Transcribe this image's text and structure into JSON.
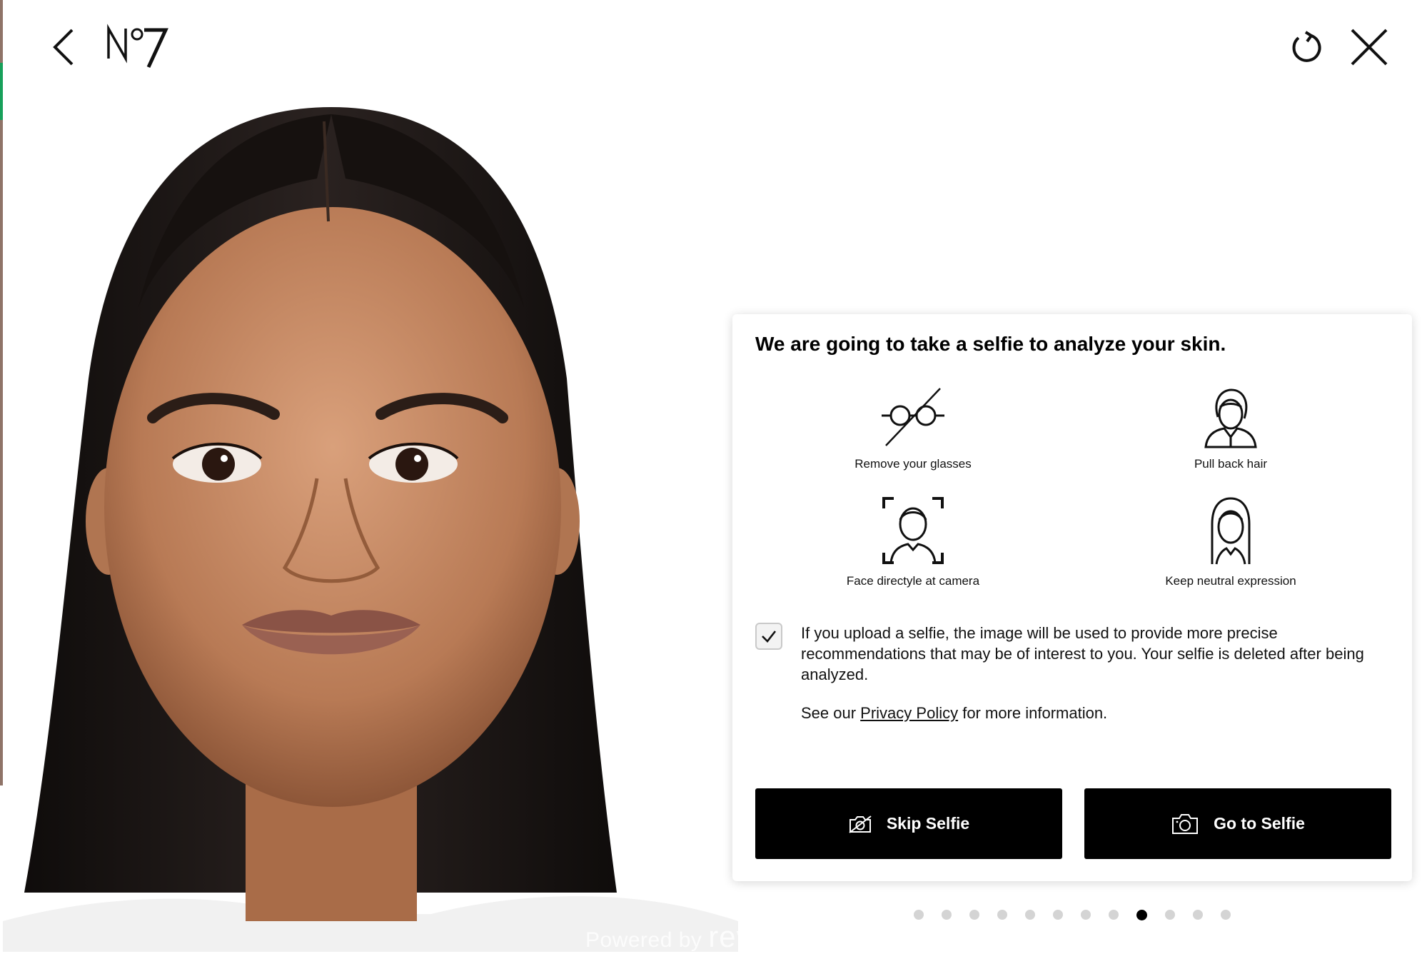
{
  "brand": {
    "logo_text": "Nº7"
  },
  "header": {
    "back_icon": "chevron-left-icon",
    "refresh_icon": "refresh-icon",
    "close_icon": "close-icon"
  },
  "card": {
    "title": "We are going to take a selfie to analyze your skin.",
    "tips": [
      {
        "icon": "no-glasses-icon",
        "label": "Remove your glasses"
      },
      {
        "icon": "hair-back-icon",
        "label": "Pull back hair"
      },
      {
        "icon": "face-frame-icon",
        "label": "Face directyle at camera"
      },
      {
        "icon": "neutral-face-icon",
        "label": "Keep neutral expression"
      }
    ],
    "consent": {
      "checked": true,
      "text": "If you upload a selfie, the image will be used to provide more precise recommendations that may be of interest to you. Your selfie is deleted after being analyzed.",
      "privacy_prefix": "See our ",
      "privacy_link": "Privacy Policy",
      "privacy_suffix": " for more information."
    },
    "buttons": {
      "skip_label": "Skip Selfie",
      "skip_icon": "camera-off-icon",
      "go_label": "Go to Selfie",
      "go_icon": "camera-icon"
    }
  },
  "pagination": {
    "total": 12,
    "active_index": 8
  },
  "footer": {
    "powered_prefix": "Powered by",
    "powered_brand": "revieve"
  },
  "colors": {
    "button_bg": "#000000",
    "dot_inactive": "#d4d4d4",
    "dot_active": "#000000",
    "skin": "#c28a66",
    "hair": "#161210"
  }
}
